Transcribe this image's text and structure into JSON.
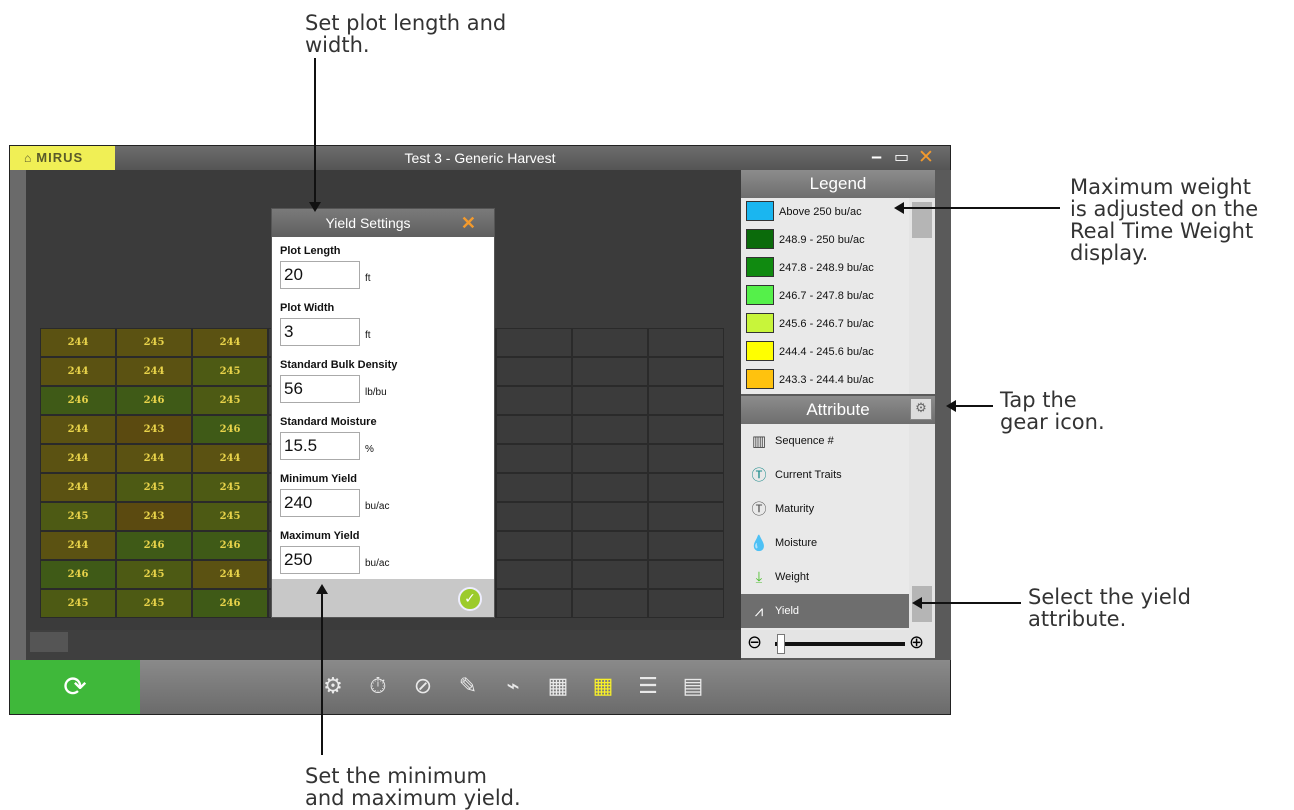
{
  "callouts": {
    "plot": "Set plot length and\nwidth.",
    "legend": "Maximum weight\nis adjusted on the\nReal Time Weight\ndisplay.",
    "gear": "Tap the\ngear icon.",
    "yield": "Select the yield\nattribute.",
    "minmax": "Set the minimum\nand maximum yield."
  },
  "window": {
    "brand": "MIRUS",
    "title": "Test 3 - Generic Harvest",
    "minimize": "‒",
    "maximize": "▭",
    "close": "✕"
  },
  "grid": {
    "rows": [
      [
        {
          "v": "244",
          "c": "#5b5212"
        },
        {
          "v": "245",
          "c": "#5b5212"
        },
        {
          "v": "244",
          "c": "#5b5212"
        }
      ],
      [
        {
          "v": "244",
          "c": "#5b5212"
        },
        {
          "v": "244",
          "c": "#5b5212"
        },
        {
          "v": "245",
          "c": "#4d5a14"
        }
      ],
      [
        {
          "v": "246",
          "c": "#3f5a17"
        },
        {
          "v": "246",
          "c": "#3f5a17"
        },
        {
          "v": "245",
          "c": "#4d5a14"
        }
      ],
      [
        {
          "v": "244",
          "c": "#5b5212"
        },
        {
          "v": "243",
          "c": "#5b4a10"
        },
        {
          "v": "246",
          "c": "#3f5a17"
        }
      ],
      [
        {
          "v": "244",
          "c": "#5b5212"
        },
        {
          "v": "244",
          "c": "#5b5212"
        },
        {
          "v": "244",
          "c": "#5b5212"
        }
      ],
      [
        {
          "v": "244",
          "c": "#5b5212"
        },
        {
          "v": "245",
          "c": "#4d5a14"
        },
        {
          "v": "245",
          "c": "#4d5a14"
        }
      ],
      [
        {
          "v": "245",
          "c": "#4d5a14"
        },
        {
          "v": "243",
          "c": "#5b4a10"
        },
        {
          "v": "245",
          "c": "#4d5a14"
        }
      ],
      [
        {
          "v": "244",
          "c": "#5b5212"
        },
        {
          "v": "246",
          "c": "#3f5a17"
        },
        {
          "v": "246",
          "c": "#3f5a17"
        }
      ],
      [
        {
          "v": "246",
          "c": "#3f5a17"
        },
        {
          "v": "245",
          "c": "#4d5a14"
        },
        {
          "v": "244",
          "c": "#5b5212"
        }
      ],
      [
        {
          "v": "245",
          "c": "#4d5a14"
        },
        {
          "v": "245",
          "c": "#4d5a14"
        },
        {
          "v": "246",
          "c": "#3f5a17"
        }
      ]
    ]
  },
  "legend": {
    "title": "Legend",
    "items": [
      {
        "label": "Above 250 bu/ac",
        "color": "#1ab6f0"
      },
      {
        "label": "248.9 - 250 bu/ac",
        "color": "#0b6b0b"
      },
      {
        "label": "247.8 - 248.9 bu/ac",
        "color": "#108a10"
      },
      {
        "label": "246.7 - 247.8 bu/ac",
        "color": "#55f04a"
      },
      {
        "label": "245.6 - 246.7 bu/ac",
        "color": "#c8f53a"
      },
      {
        "label": "244.4 - 245.6 bu/ac",
        "color": "#ffff00"
      },
      {
        "label": "243.3 - 244.4 bu/ac",
        "color": "#ffc20e"
      }
    ]
  },
  "attribute": {
    "title": "Attribute",
    "items": [
      {
        "label": "Sequence #",
        "icon": "barcode-icon"
      },
      {
        "label": "Current Traits",
        "icon": "trait-icon"
      },
      {
        "label": "Maturity",
        "icon": "maturity-icon"
      },
      {
        "label": "Moisture",
        "icon": "droplet-icon"
      },
      {
        "label": "Weight",
        "icon": "weight-icon"
      },
      {
        "label": "Yield",
        "icon": "yield-icon"
      }
    ],
    "selected": "Yield"
  },
  "dialog": {
    "title": "Yield Settings",
    "close": "✕",
    "fields": [
      {
        "label": "Plot Length",
        "value": "20",
        "unit": "ft"
      },
      {
        "label": "Plot Width",
        "value": "3",
        "unit": "ft"
      },
      {
        "label": "Standard Bulk Density",
        "value": "56",
        "unit": "lb/bu"
      },
      {
        "label": "Standard Moisture",
        "value": "15.5",
        "unit": "%"
      },
      {
        "label": "Minimum Yield",
        "value": "240",
        "unit": "bu/ac"
      },
      {
        "label": "Maximum Yield",
        "value": "250",
        "unit": "bu/ac"
      }
    ]
  },
  "toolbar": {
    "accent": "#3fb83a",
    "tools": [
      "gear-icon",
      "stopwatch-icon",
      "compass-icon",
      "pencil-icon",
      "chart-icon",
      "tiles-icon",
      "map-icon",
      "table-icon",
      "calculator-icon"
    ]
  }
}
